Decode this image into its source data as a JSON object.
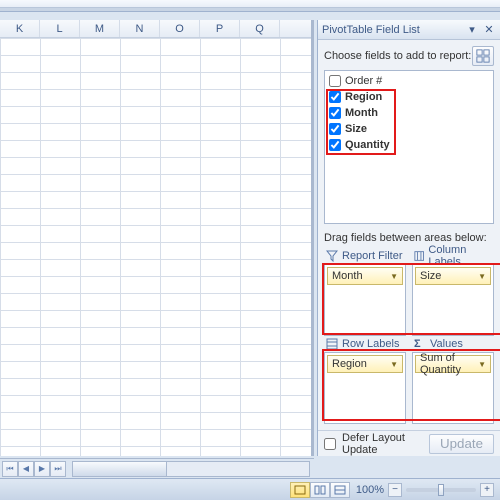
{
  "columns": [
    "K",
    "L",
    "M",
    "N",
    "O",
    "P",
    "Q"
  ],
  "pane": {
    "title": "PivotTable Field List",
    "choose_label": "Choose fields to add to report:",
    "fields": [
      {
        "label": "Order #",
        "checked": false
      },
      {
        "label": "Region",
        "checked": true
      },
      {
        "label": "Month",
        "checked": true
      },
      {
        "label": "Size",
        "checked": true
      },
      {
        "label": "Quantity",
        "checked": true
      }
    ],
    "drag_label": "Drag fields between areas below:",
    "areas": {
      "report_filter": {
        "title": "Report Filter",
        "chips": [
          "Month"
        ]
      },
      "column_labels": {
        "title": "Column Labels",
        "chips": [
          "Size"
        ]
      },
      "row_labels": {
        "title": "Row Labels",
        "chips": [
          "Region"
        ]
      },
      "values": {
        "title": "Values",
        "chips": [
          "Sum of Quantity"
        ]
      }
    },
    "defer_label": "Defer Layout Update",
    "update_label": "Update"
  },
  "status": {
    "zoom": "100%"
  }
}
